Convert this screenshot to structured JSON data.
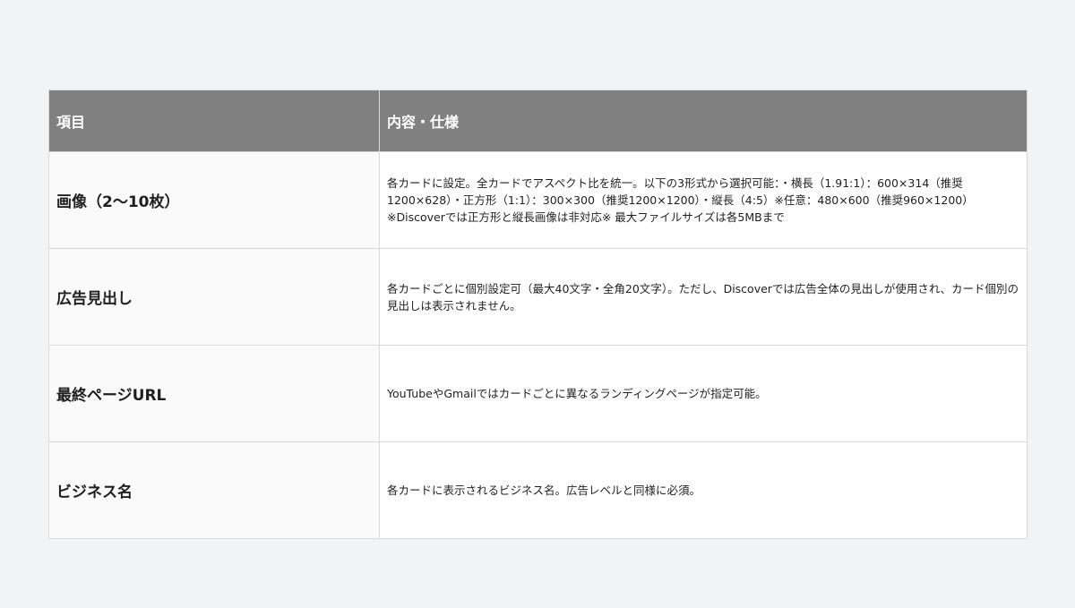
{
  "table": {
    "headers": [
      "項目",
      "内容・仕様"
    ],
    "rows": [
      {
        "item": "画像（2〜10枚）",
        "description": "各カードに設定。全カードでアスペクト比を統一。以下の3形式から選択可能：・横長（1.91:1）：600×314（推奨1200×628）・正方形（1:1）：300×300（推奨1200×1200）・縦長（4:5）※任意：480×600（推奨960×1200）※Discoverでは正方形と縦長画像は非対応※ 最大ファイルサイズは各5MBまで"
      },
      {
        "item": "広告見出し",
        "description": "各カードごとに個別設定可（最大40文字・全角20文字）。ただし、Discoverでは広告全体の見出しが使用され、カード個別の見出しは表示されません。"
      },
      {
        "item": "最終ページURL",
        "description": "YouTubeやGmailではカードごとに異なるランディングページが指定可能。"
      },
      {
        "item": "ビジネス名",
        "description": "各カードに表示されるビジネス名。広告レベルと同様に必須。"
      }
    ]
  }
}
